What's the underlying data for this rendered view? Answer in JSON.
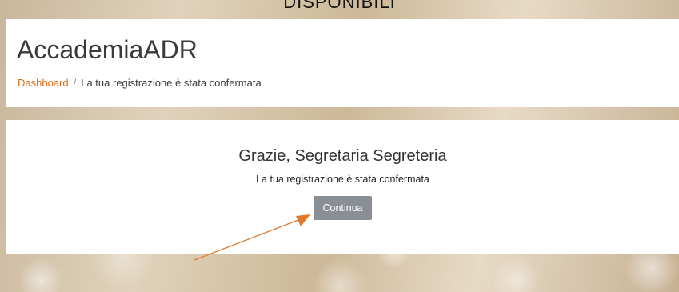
{
  "top_banner": {
    "title": "DISPONIBILI"
  },
  "header": {
    "site_name": "AccademiaADR",
    "breadcrumb": {
      "link": "Dashboard",
      "separator": "/",
      "current": "La tua registrazione è stata confermata"
    }
  },
  "main": {
    "greeting": "Grazie, Segretaria Segreteria",
    "message": "La tua registrazione è stata confermata",
    "continue_label": "Continua"
  },
  "annotation": {
    "icon": "arrow-icon",
    "color": "#e07a2a"
  },
  "colors": {
    "accent": "#e06c1a",
    "button": "#8a8f96"
  }
}
